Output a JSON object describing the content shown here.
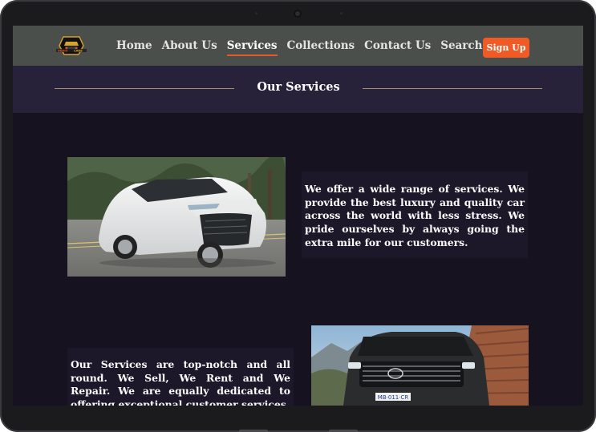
{
  "brand": {
    "logo_text": "DEXIO CARS",
    "accent": "#f05a24"
  },
  "nav": {
    "links": [
      {
        "label": "Home",
        "active": false
      },
      {
        "label": "About Us",
        "active": false
      },
      {
        "label": "Services",
        "active": true
      },
      {
        "label": "Collections",
        "active": false
      },
      {
        "label": "Contact Us",
        "active": false
      }
    ],
    "search_label": "Search",
    "search_icon": "search-icon",
    "signup_label": "Sign Up"
  },
  "section": {
    "title": "Our Services"
  },
  "services": [
    {
      "image": "white-lexus-suv-photo",
      "text": "We offer a wide range of services. We provide the best luxury and quality car across the world with less stress. We pride ourselves by always going the extra mile for our customers."
    },
    {
      "image": "black-toyota-land-cruiser-photo",
      "text": "Our Services are top-notch and all round. We Sell, We Rent and We Repair. We are equally dedicated to offering exceptional customer services."
    }
  ],
  "car2_plate": "MB·011·CR",
  "colors": {
    "nav_bg": "#4a4f4b",
    "header_bg": "#27223a",
    "page_bg": "#17121f"
  }
}
